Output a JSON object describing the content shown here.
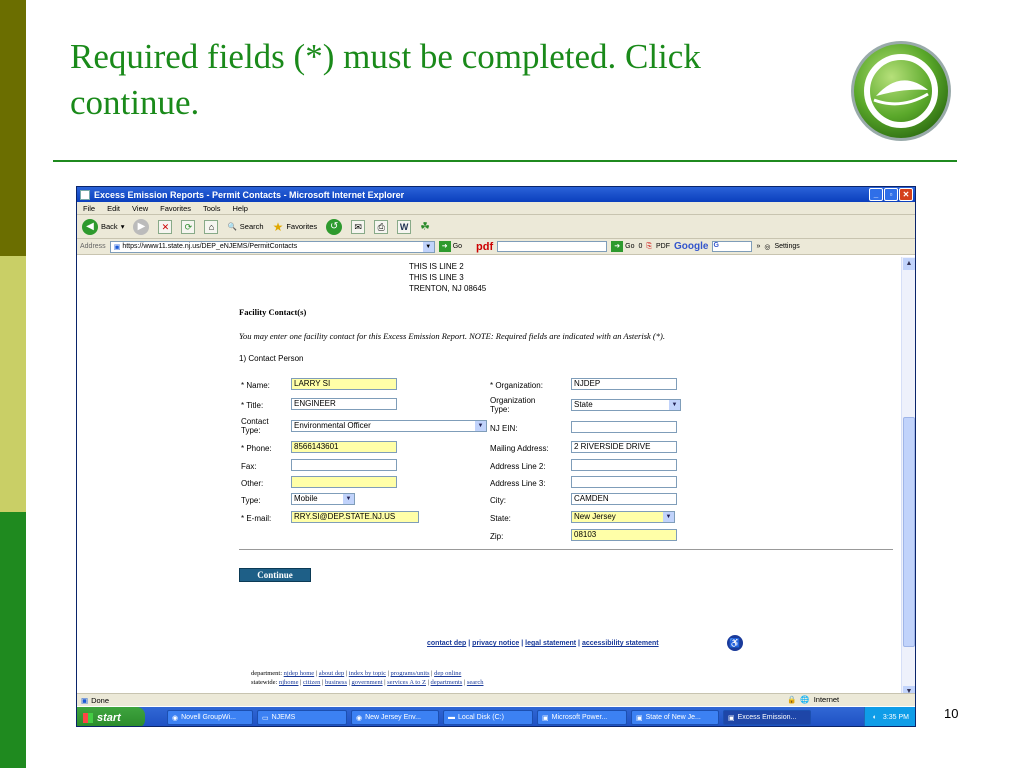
{
  "slide": {
    "title": "Required fields (*) must be completed. Click continue.",
    "page_number": "10"
  },
  "browser": {
    "window_title": "Excess Emission Reports - Permit Contacts - Microsoft Internet Explorer",
    "menu": [
      "File",
      "Edit",
      "View",
      "Favorites",
      "Tools",
      "Help"
    ],
    "toolbar": {
      "back": "Back",
      "search": "Search",
      "favorites": "Favorites"
    },
    "address_label": "Address",
    "address_url": "https://www11.state.nj.us/DEP_eNJEMS/PermitContacts",
    "go_label": "Go",
    "pdf_label": "pdf",
    "go2_label": "Go",
    "count_label": "0",
    "pdf2_label": "PDF",
    "google_label": "Google",
    "google_g": "G",
    "settings_label": "Settings",
    "status": "Done",
    "zone": "Internet"
  },
  "page": {
    "address_lines": [
      "THIS IS LINE 2",
      "THIS IS LINE 3",
      "TRENTON,  NJ  08645"
    ],
    "section_title": "Facility Contact(s)",
    "note": "You may enter one facility contact for this Excess Emission Report. NOTE: Required fields are indicated with an Asterisk (*).",
    "contact_label": "1) Contact Person",
    "left_fields": {
      "name_label": "* Name:",
      "name_value": "LARRY SI",
      "title_label": "* Title:",
      "title_value": "ENGINEER",
      "contact_type_label": "Contact Type:",
      "contact_type_value": "Environmental Officer",
      "phone_label": "* Phone:",
      "phone_value": "8566143601",
      "fax_label": "Fax:",
      "fax_value": "",
      "other_label": "Other:",
      "other_value": "",
      "type_label": "Type:",
      "type_value": "Mobile",
      "email_label": "* E-mail:",
      "email_value": "RRY.SI@DEP.STATE.NJ.US"
    },
    "right_fields": {
      "org_label": "* Organization:",
      "org_value": "NJDEP",
      "org_type_label": "Organization Type:",
      "org_type_value": "State",
      "ein_label": "NJ EIN:",
      "ein_value": "",
      "mailing_label": "Mailing Address:",
      "mailing_value": "2 RIVERSIDE DRIVE",
      "addr2_label": "Address Line 2:",
      "addr2_value": "",
      "addr3_label": "Address Line 3:",
      "addr3_value": "",
      "city_label": "City:",
      "city_value": "CAMDEN",
      "state_label": "State:",
      "state_value": "New Jersey",
      "zip_label": "Zip:",
      "zip_value": "08103"
    },
    "continue_label": "Continue",
    "footer_links": [
      "contact dep",
      "privacy notice",
      "legal statement",
      "accessibility statement"
    ],
    "dept_prefix": "department:",
    "dept_links": [
      "njdep home",
      "about dep",
      "index by topic",
      "programs/units",
      "dep online"
    ],
    "statewide_prefix": "statewide:",
    "statewide_links": [
      "njhome",
      "citizen",
      "business",
      "government",
      "services A to Z",
      "departments",
      "search"
    ]
  },
  "taskbar": {
    "start": "start",
    "tasks": [
      "Novell GroupWi...",
      "NJEMS",
      "New Jersey Env...",
      "Local Disk (C:)",
      "Microsoft Power...",
      "State of New Je...",
      "Excess Emission..."
    ],
    "clock": "3:35 PM"
  }
}
